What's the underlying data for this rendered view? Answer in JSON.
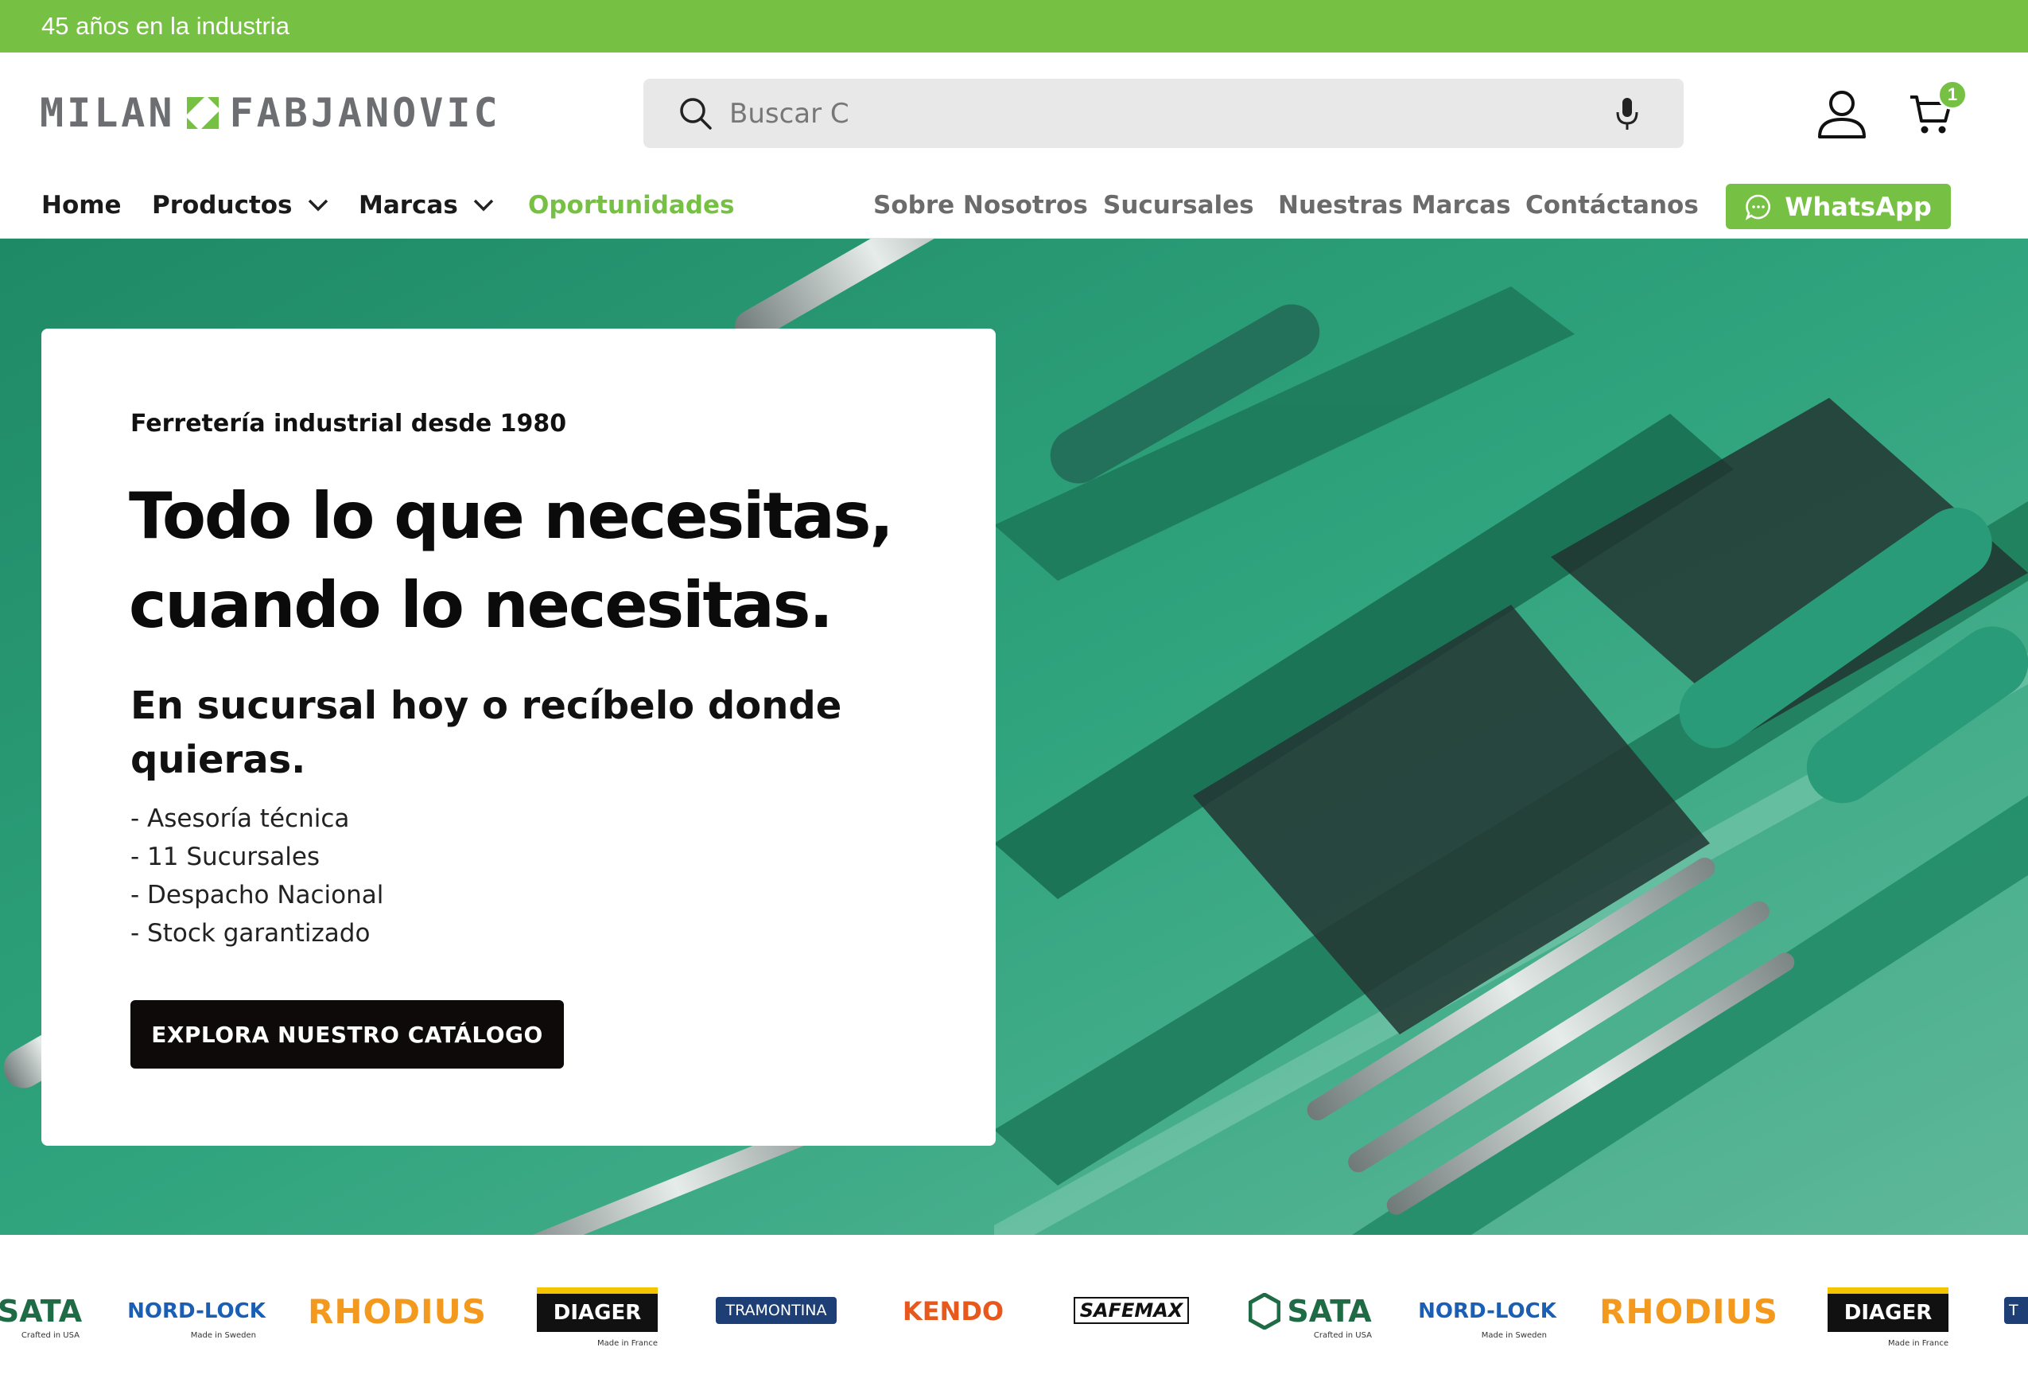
{
  "topbar": {
    "text": "45 años en la industria"
  },
  "header": {
    "logo_left": "MILAN",
    "logo_right": "FABJANOVIC",
    "search_placeholder": "Buscar C",
    "cart_count": "1",
    "icons": {
      "search": "search-icon",
      "mic": "microphone-icon",
      "account": "user-icon",
      "cart": "cart-icon"
    }
  },
  "nav": {
    "items": [
      {
        "label": "Home"
      },
      {
        "label": "Productos"
      },
      {
        "label": "Marcas"
      },
      {
        "label": "Oportunidades"
      },
      {
        "label": "Sobre Nosotros"
      },
      {
        "label": "Sucursales"
      },
      {
        "label": "Nuestras Marcas"
      },
      {
        "label": "Contáctanos"
      }
    ],
    "whatsapp_label": "WhatsApp"
  },
  "hero": {
    "eyebrow": "Ferretería industrial desde 1980",
    "title_line1": "Todo lo que necesitas,",
    "title_line2": "cuando lo necesitas.",
    "subtitle": "En sucursal hoy o recíbelo donde quieras.",
    "bullets": [
      "- Asesoría técnica",
      "- 11 Sucursales",
      "- Despacho Nacional",
      "- Stock garantizado"
    ],
    "cta_label": "EXPLORA NUESTRO CATÁLOGO"
  },
  "brands": [
    {
      "name": "SATA",
      "tag": "Crafted in USA"
    },
    {
      "name": "NORD-LOCK",
      "tag": "Made in Sweden"
    },
    {
      "name": "RHODIUS",
      "tag": ""
    },
    {
      "name": "DIAGER",
      "tag": "Made in France"
    },
    {
      "name": "TRAMONTINA",
      "tag": ""
    },
    {
      "name": "KENDO",
      "tag": ""
    },
    {
      "name": "SAFEMAX",
      "tag": ""
    },
    {
      "name": "SATA",
      "tag": "Crafted in USA"
    },
    {
      "name": "NORD-LOCK",
      "tag": "Made in Sweden"
    },
    {
      "name": "RHODIUS",
      "tag": ""
    },
    {
      "name": "DIAGER",
      "tag": "Made in France"
    },
    {
      "name": "T",
      "tag": ""
    }
  ],
  "colors": {
    "brand_green": "#76c043",
    "dark": "#0e0a0a",
    "teal": "#2a9a74"
  }
}
